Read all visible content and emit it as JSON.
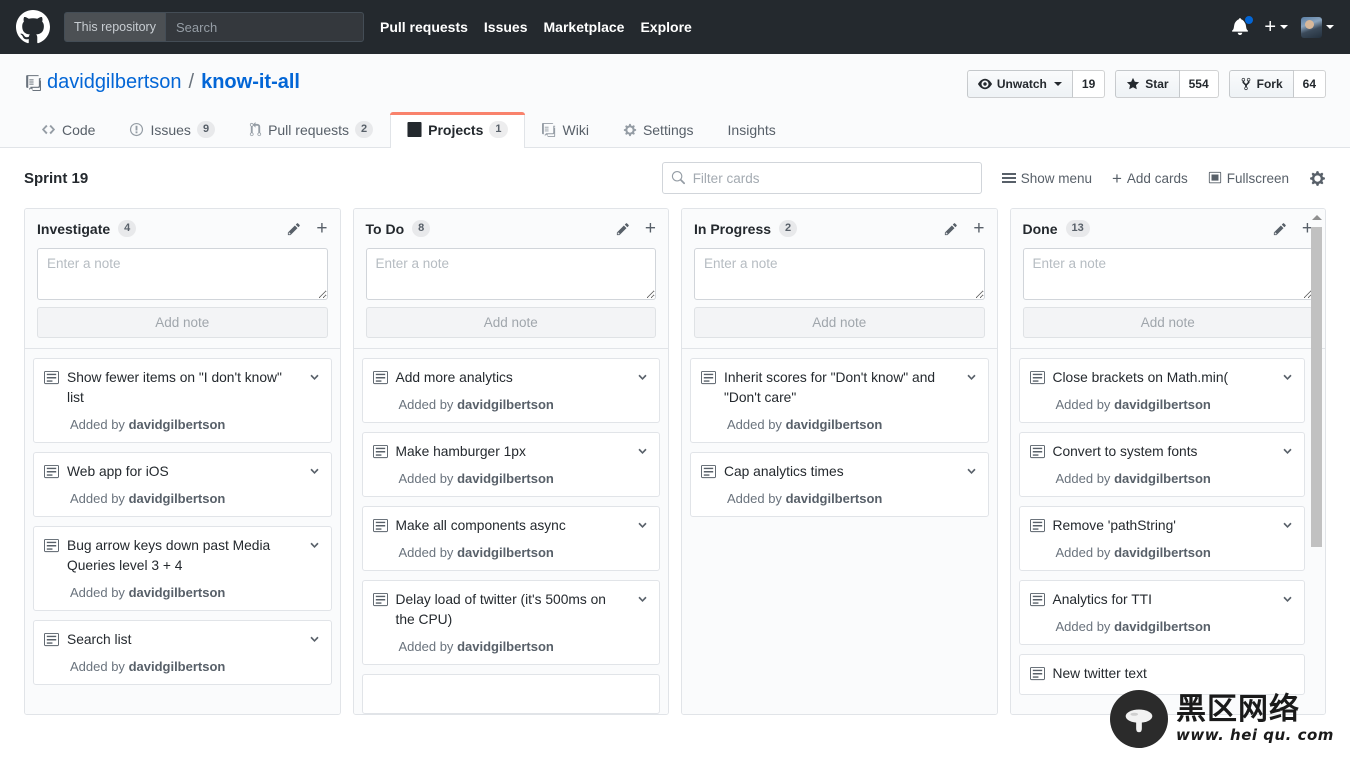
{
  "header": {
    "logo_icon": "github-mark-icon",
    "search": {
      "scope_label": "This repository",
      "placeholder": "Search",
      "value": ""
    },
    "nav": [
      {
        "label": "Pull requests"
      },
      {
        "label": "Issues"
      },
      {
        "label": "Marketplace"
      },
      {
        "label": "Explore"
      }
    ],
    "notifications_icon": "bell-icon",
    "has_notification_dot": true,
    "create_new_icon": "plus-icon",
    "avatar_icon": "user-avatar",
    "accent_blue": "#0366d6",
    "bar_background": "#24292e"
  },
  "repo": {
    "icon": "repo-book-icon",
    "owner": "davidgilbertson",
    "separator": "/",
    "name": "know-it-all",
    "actions": [
      {
        "icon": "eye-icon",
        "label": "Unwatch",
        "has_caret": true,
        "count": "19"
      },
      {
        "icon": "star-icon",
        "label": "Star",
        "has_caret": false,
        "count": "554"
      },
      {
        "icon": "fork-icon",
        "label": "Fork",
        "has_caret": false,
        "count": "64"
      }
    ],
    "tabs": [
      {
        "icon": "code-icon",
        "label": "Code",
        "count": "",
        "selected": false
      },
      {
        "icon": "issue-opened-icon",
        "label": "Issues",
        "count": "9",
        "selected": false
      },
      {
        "icon": "git-pull-request-icon",
        "label": "Pull requests",
        "count": "2",
        "selected": false
      },
      {
        "icon": "project-icon",
        "label": "Projects",
        "count": "1",
        "selected": true
      },
      {
        "icon": "book-icon",
        "label": "Wiki",
        "count": "",
        "selected": false
      },
      {
        "icon": "gear-icon",
        "label": "Settings",
        "count": "",
        "selected": false
      },
      {
        "icon": "graph-icon",
        "label": "Insights",
        "count": "",
        "selected": false,
        "has_caret": true
      }
    ],
    "selected_tab_accent": "#f9826c"
  },
  "project": {
    "name": "Sprint 19",
    "filter": {
      "placeholder": "Filter cards",
      "value": "",
      "icon": "search-icon"
    },
    "tools": [
      {
        "icon": "hamburger-icon",
        "label": "Show menu"
      },
      {
        "icon": "plus-icon",
        "label": "Add cards"
      },
      {
        "icon": "fullscreen-icon",
        "label": "Fullscreen"
      }
    ],
    "settings_icon": "gear-icon"
  },
  "board": {
    "note_placeholder": "Enter a note",
    "add_note_label": "Add note",
    "added_by_prefix": "Added by",
    "author": "davidgilbertson",
    "edit_icon": "pencil-icon",
    "add_icon": "plus-icon",
    "card_icon": "note-card-icon",
    "card_menu_icon": "chevron-down-icon",
    "columns": [
      {
        "title": "Investigate",
        "count": "4",
        "has_scrollbar": false,
        "cards": [
          {
            "title": "Show fewer items on \"I don't know\" list"
          },
          {
            "title": "Web app for iOS"
          },
          {
            "title": "Bug arrow keys down past Media Queries level 3 + 4"
          },
          {
            "title": "Search list"
          }
        ]
      },
      {
        "title": "To Do",
        "count": "8",
        "has_scrollbar": false,
        "cards": [
          {
            "title": "Add more analytics"
          },
          {
            "title": "Make hamburger 1px"
          },
          {
            "title": "Make all components async"
          },
          {
            "title": "Delay load of twitter (it's 500ms on the CPU)"
          },
          {
            "title": ""
          }
        ]
      },
      {
        "title": "In Progress",
        "count": "2",
        "has_scrollbar": false,
        "cards": [
          {
            "title": "Inherit scores for \"Don't know\" and \"Don't care\""
          },
          {
            "title": "Cap analytics times"
          }
        ]
      },
      {
        "title": "Done",
        "count": "13",
        "has_scrollbar": true,
        "cards": [
          {
            "title": "Close brackets on Math.min("
          },
          {
            "title": "Convert to system fonts"
          },
          {
            "title": "Remove 'pathString'"
          },
          {
            "title": "Analytics for TTI"
          },
          {
            "title": "New twitter text"
          }
        ]
      }
    ]
  },
  "watermark": {
    "logo_icon": "mushroom-logo-icon",
    "title": "黑区网络",
    "url": "www. hei qu. com"
  }
}
